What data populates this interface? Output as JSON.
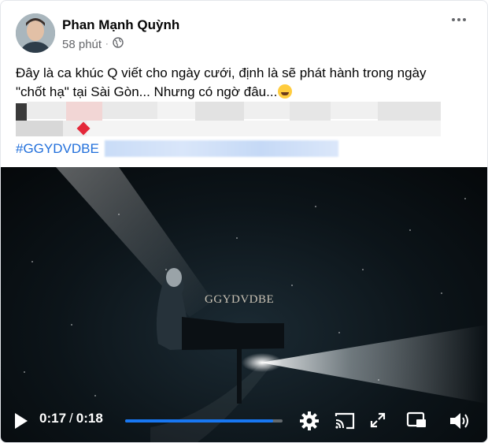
{
  "post": {
    "author": "Phan Mạnh Quỳnh",
    "time": "58 phút",
    "separator": "·",
    "privacy_icon": "globe-icon",
    "more_icon": "more-options-icon",
    "text_line1": "Đây là ca khúc Q viết cho ngày cưới, định là sẽ phát hành trong ngày",
    "text_line2": "\"chốt hạ\" tại Sài Gòn... Nhưng có ngờ đâu...",
    "emoji": "rolling-on-floor-laughing-emoji",
    "hashtag_visible": "#GGYDVDBE",
    "hashtags_blurred": "#PMQ #HKV #verylongtimewedding"
  },
  "video": {
    "watermark": "GGYDVDBE",
    "current_time": "0:17",
    "time_separator": "/",
    "duration": "0:18",
    "progress": 0.94,
    "accent_color": "#1877f2"
  }
}
